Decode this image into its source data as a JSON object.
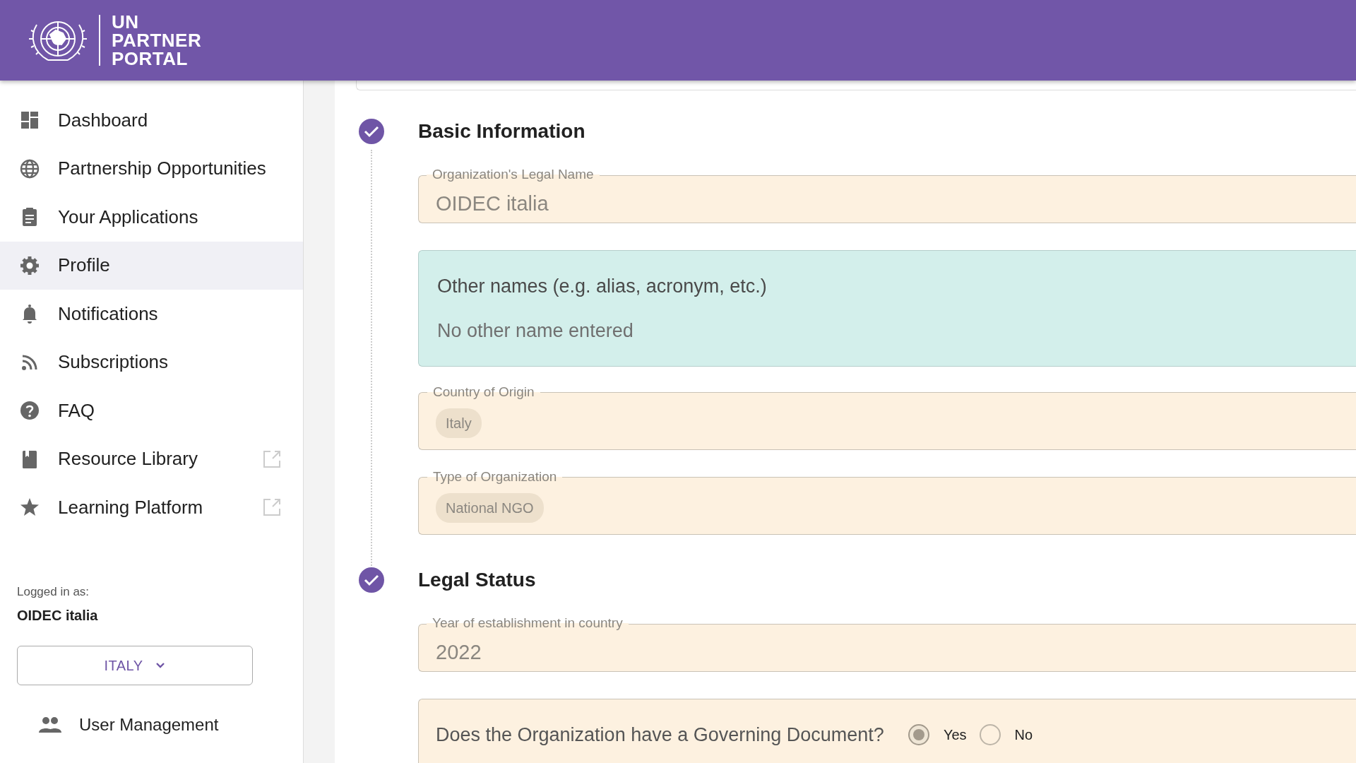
{
  "header": {
    "logo_lines": [
      "UN",
      "PARTNER",
      "PORTAL"
    ]
  },
  "sidebar": {
    "items": [
      {
        "label": "Dashboard",
        "selected": false,
        "external": false
      },
      {
        "label": "Partnership Opportunities",
        "selected": false,
        "external": false
      },
      {
        "label": "Your Applications",
        "selected": false,
        "external": false
      },
      {
        "label": "Profile",
        "selected": true,
        "external": false
      },
      {
        "label": "Notifications",
        "selected": false,
        "external": false
      },
      {
        "label": "Subscriptions",
        "selected": false,
        "external": false
      },
      {
        "label": "FAQ",
        "selected": false,
        "external": false
      },
      {
        "label": "Resource Library",
        "selected": false,
        "external": true
      },
      {
        "label": "Learning Platform",
        "selected": false,
        "external": true
      }
    ],
    "logged_in_label": "Logged in as:",
    "logged_in_name": "OIDEC italia",
    "country_button": "ITALY",
    "user_management": "User Management"
  },
  "sections": [
    {
      "title": "Basic Information",
      "completed": true,
      "fields": [
        {
          "kind": "text",
          "label": "Organization's Legal Name",
          "value": "OIDEC italia"
        },
        {
          "kind": "info",
          "label": "Other names (e.g. alias, acronym, etc.)",
          "value": "No other name entered"
        },
        {
          "kind": "chips",
          "label": "Country of Origin",
          "chips": [
            "Italy"
          ]
        },
        {
          "kind": "chips",
          "label": "Type of Organization",
          "chips": [
            "National NGO"
          ]
        }
      ]
    },
    {
      "title": "Legal Status",
      "completed": true,
      "fields": [
        {
          "kind": "text",
          "label": "Year of establishment in country",
          "value": "2022"
        },
        {
          "kind": "radio",
          "label": "Does the Organization have a Governing Document?",
          "options": [
            {
              "label": "Yes",
              "selected": true
            },
            {
              "label": "No",
              "selected": false
            }
          ]
        }
      ]
    }
  ]
}
